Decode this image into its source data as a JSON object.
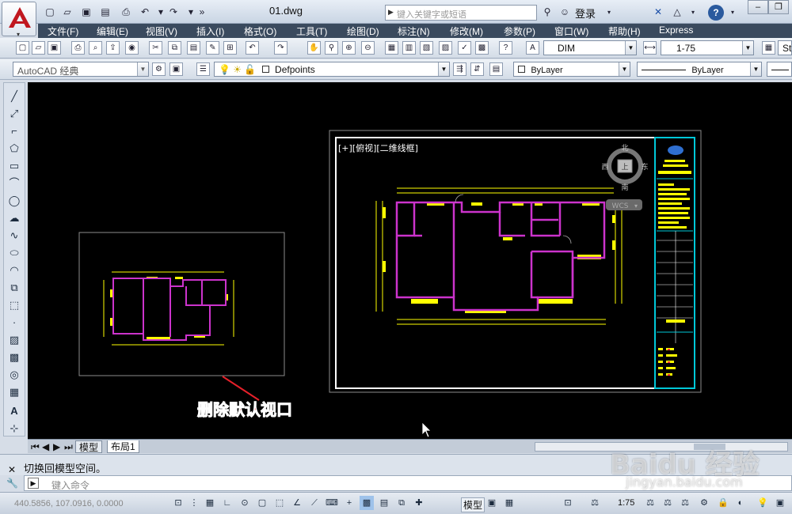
{
  "window": {
    "doc_title": "01.dwg",
    "search_placeholder": "键入关键字或短语",
    "login": "登录",
    "help": "?"
  },
  "menu": [
    "文件(F)",
    "编辑(E)",
    "视图(V)",
    "插入(I)",
    "格式(O)",
    "工具(T)",
    "绘图(D)",
    "标注(N)",
    "修改(M)",
    "参数(P)",
    "窗口(W)",
    "帮助(H)",
    "Express"
  ],
  "toolbar": {
    "dim_style": "DIM",
    "scale": "1-75",
    "st_label": "St",
    "workspace": "AutoCAD 经典",
    "layer": "Defpoints",
    "color": "ByLayer",
    "linetype": "ByLayer"
  },
  "viewport": {
    "label": "[+][俯视][二维线框]",
    "compass": {
      "north": "北",
      "south": "南",
      "east": "东",
      "west": "西",
      "center": "上"
    },
    "wcs": "WCS"
  },
  "annotation": {
    "text": "删除默认视口",
    "color": "#e5202a"
  },
  "layout_tabs": [
    "模型",
    "布局1"
  ],
  "cmd": {
    "history": "切换回模型空间。",
    "placeholder": "键入命令"
  },
  "statusbar": {
    "coords": "440.5856, 107.0916, 0.0000",
    "space": "模型",
    "scale": "1:75"
  },
  "watermark": {
    "brand": "Baidu 经验",
    "url": "jingyan.baidu.com"
  }
}
